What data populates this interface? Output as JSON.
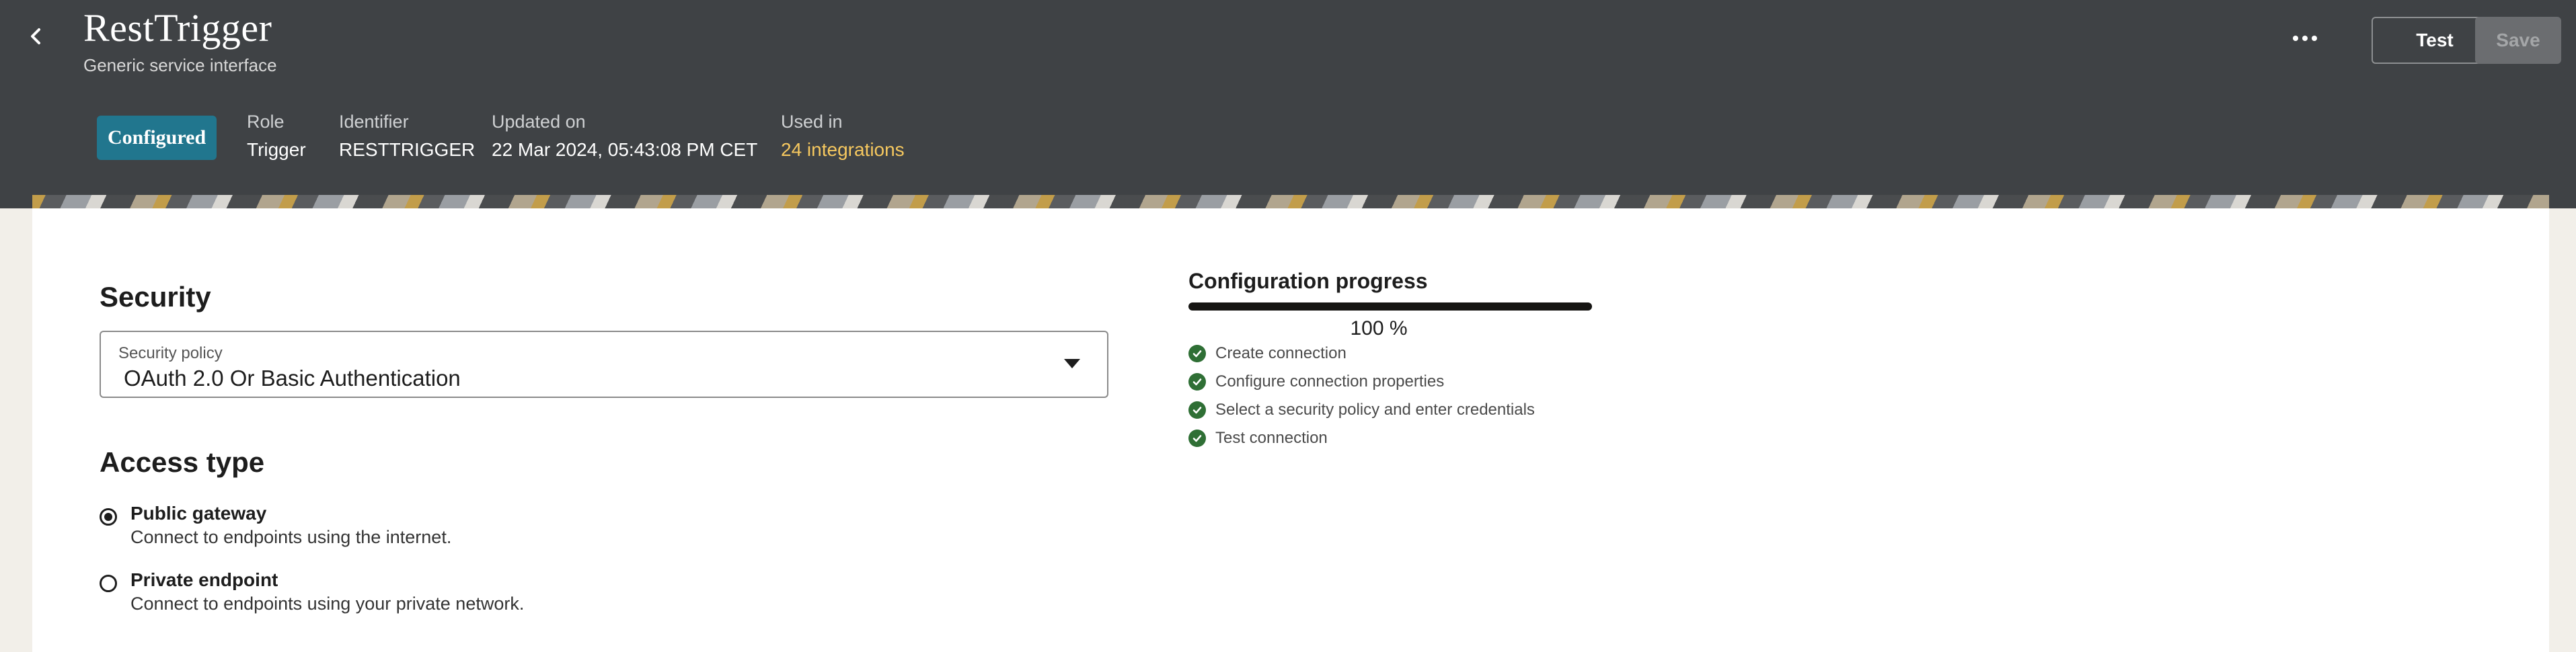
{
  "header": {
    "title": "RestTrigger",
    "subtitle": "Generic service interface",
    "test_label": "Test",
    "save_label": "Save",
    "status_badge": "Configured",
    "role_label": "Role",
    "role_value": "Trigger",
    "identifier_label": "Identifier",
    "identifier_value": "RESTTRIGGER",
    "updated_label": "Updated on",
    "updated_value": "22 Mar 2024, 05:43:08 PM CET",
    "used_label": "Used in",
    "used_value": "24 integrations"
  },
  "security": {
    "title": "Security",
    "policy_label": "Security policy",
    "policy_value": "OAuth 2.0 Or Basic Authentication"
  },
  "access": {
    "title": "Access type",
    "options": [
      {
        "title": "Public gateway",
        "desc": "Connect to endpoints using the internet.",
        "selected": true
      },
      {
        "title": "Private endpoint",
        "desc": "Connect to endpoints using your private network.",
        "selected": false
      }
    ]
  },
  "progress": {
    "title": "Configuration progress",
    "percent": 100,
    "percent_label": "100 %",
    "steps": [
      "Create connection",
      "Configure connection properties",
      "Select a security policy and enter credentials",
      "Test connection"
    ]
  },
  "colors": {
    "header_bg": "#3f4245",
    "badge": "#21768e",
    "link": "#f6c85f",
    "check": "#2f6f35"
  },
  "icons": [
    "chevron-left-icon",
    "more-icon",
    "caret-down-icon",
    "check-circle-icon"
  ]
}
